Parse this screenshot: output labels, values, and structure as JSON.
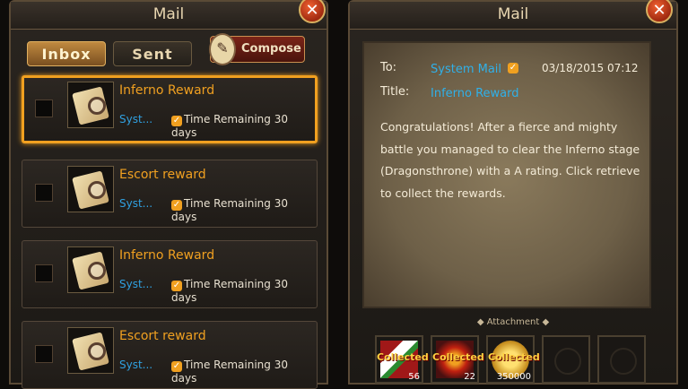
{
  "left_panel": {
    "title": "Mail",
    "close_label": "✕",
    "tabs": [
      {
        "label": "Inbox"
      },
      {
        "label": "Sent"
      }
    ],
    "compose_label": "Compose",
    "mails": [
      {
        "subject": "Inferno Reward",
        "sender": "Syst...",
        "time": "Time Remaining 30 days",
        "selected": true
      },
      {
        "subject": "Escort reward",
        "sender": "Syst...",
        "time": "Time Remaining 30 days",
        "selected": false
      },
      {
        "subject": "Inferno Reward",
        "sender": "Syst...",
        "time": "Time Remaining 30 days",
        "selected": false
      },
      {
        "subject": "Escort reward",
        "sender": "Syst...",
        "time": "Time Remaining 30 days",
        "selected": false
      }
    ]
  },
  "right_panel": {
    "title": "Mail",
    "close_label": "✕",
    "to_label": "To:",
    "to_value": "System Mail",
    "date": "03/18/2015 07:12",
    "title_label": "Title:",
    "title_value": "Inferno Reward",
    "body": "Congratulations! After a fierce and mighty battle you managed to clear the Inferno stage (Dragonsthrone) with a A rating. Click retrieve to collect the rewards.",
    "attachment_label": "Attachment",
    "attachments": [
      {
        "status": "Collected",
        "quantity": "56",
        "icon": "red-white-gem-icon"
      },
      {
        "status": "Collected",
        "quantity": "22",
        "icon": "red-crest-icon"
      },
      {
        "status": "Collected",
        "quantity": "350000",
        "icon": "gold-coin-icon"
      }
    ]
  },
  "colors": {
    "accent_orange": "#f0a020",
    "sender_blue": "#30a0e0",
    "frame_brown": "#5a4a36"
  }
}
